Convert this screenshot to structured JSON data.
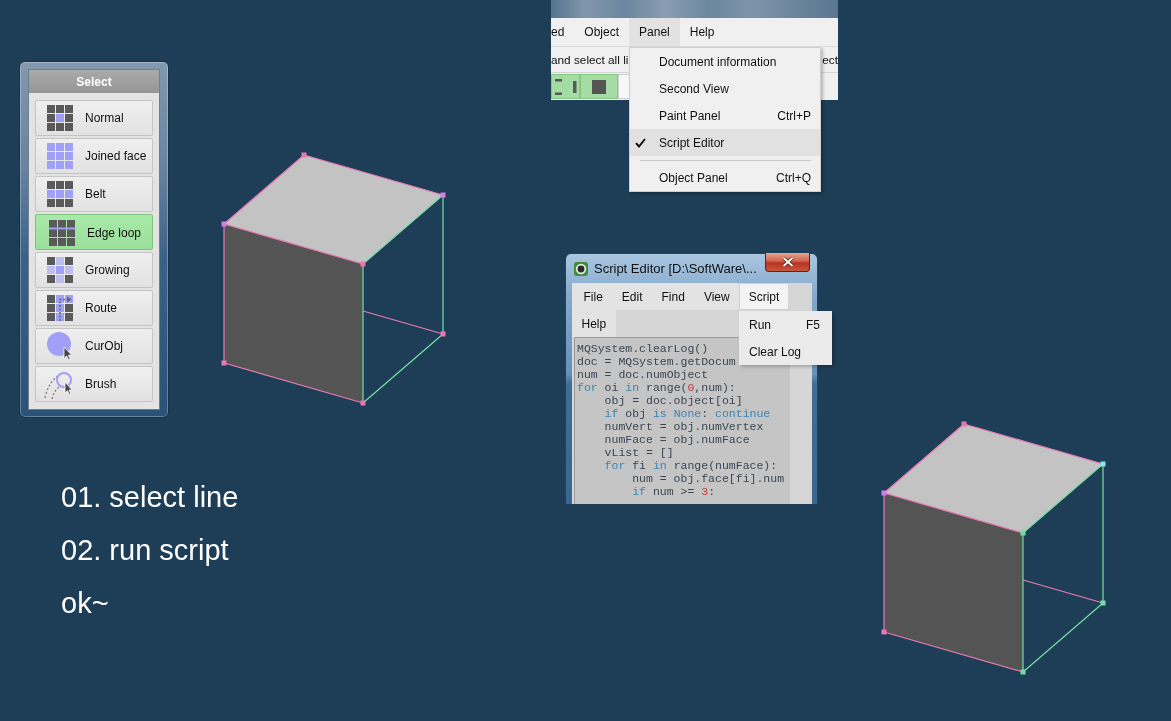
{
  "select_panel": {
    "title": "Select",
    "modes": [
      {
        "label": "Normal",
        "selected": false
      },
      {
        "label": "Joined face",
        "selected": false
      },
      {
        "label": "Belt",
        "selected": false
      },
      {
        "label": "Edge loop",
        "selected": true
      },
      {
        "label": "Growing",
        "selected": false
      },
      {
        "label": "Route",
        "selected": false
      },
      {
        "label": "CurObj",
        "selected": false
      },
      {
        "label": "Brush",
        "selected": false
      }
    ]
  },
  "main_window": {
    "menu_bar": [
      {
        "label": "ed",
        "selected": false
      },
      {
        "label": "Object",
        "selected": false
      },
      {
        "label": "Panel",
        "selected": true
      },
      {
        "label": "Help",
        "selected": false
      }
    ],
    "toolbar_text": "and select all li",
    "toolbar_text_right": "ect",
    "tool_buttons": [
      {
        "selected": true
      },
      {
        "selected": true
      },
      {
        "selected": false
      }
    ],
    "panel_menu": [
      {
        "kind": "item",
        "label": "Document information",
        "checked": false,
        "highlighted": false
      },
      {
        "kind": "item",
        "label": "Second View",
        "checked": false,
        "highlighted": false
      },
      {
        "kind": "item",
        "label": "Paint Panel",
        "shortcut": "Ctrl+P",
        "checked": false,
        "highlighted": false
      },
      {
        "kind": "item",
        "label": "Script Editor",
        "checked": true,
        "highlighted": true
      },
      {
        "kind": "separator"
      },
      {
        "kind": "item",
        "label": "Object Panel",
        "shortcut": "Ctrl+Q",
        "checked": false,
        "highlighted": false
      }
    ]
  },
  "cubes": [
    {
      "edges": [
        {
          "selected": false
        },
        {
          "selected": false
        },
        {
          "selected": false
        },
        {
          "selected": true
        },
        {
          "selected": false
        },
        {
          "selected": false
        },
        {
          "selected": true
        },
        {
          "selected": true
        },
        {
          "selected": true
        },
        {
          "selected": false
        }
      ],
      "vertices": [
        {
          "color": "#e878b4"
        },
        {
          "color": "#d47ee6"
        },
        {
          "color": "#d47ee6"
        },
        {
          "color": "#e878b4"
        },
        {
          "color": "#e878b4"
        },
        {
          "color": "#e878b4"
        },
        {
          "color": "#e878b4"
        }
      ]
    },
    {
      "edges": [
        {
          "selected": false
        },
        {
          "selected": false
        },
        {
          "selected": false
        },
        {
          "selected": true
        },
        {
          "selected": false
        },
        {
          "selected": false
        },
        {
          "selected": true
        },
        {
          "selected": true
        },
        {
          "selected": true
        },
        {
          "selected": false
        }
      ],
      "vertices": [
        {
          "color": "#e878b4"
        },
        {
          "color": "#80e6f0"
        },
        {
          "color": "#d47ee6"
        },
        {
          "color": "#70dea0"
        },
        {
          "color": "#e878b4"
        },
        {
          "color": "#70dea0"
        },
        {
          "color": "#70dea0"
        }
      ]
    }
  ],
  "script_editor": {
    "title": "Script Editor [D:\\SoftWare\\...",
    "menu_bar": [
      {
        "label": "File",
        "selected": false
      },
      {
        "label": "Edit",
        "selected": false
      },
      {
        "label": "Find",
        "selected": false
      },
      {
        "label": "View",
        "selected": false
      },
      {
        "label": "Script",
        "selected": true
      },
      {
        "label": "Help",
        "selected": false
      }
    ],
    "script_menu": [
      {
        "label": "Run",
        "shortcut": "F5"
      },
      {
        "label": "Clear Log"
      }
    ],
    "code": [
      [
        {
          "kind": "plain",
          "text": "MQSystem.clearLog()"
        }
      ],
      [
        {
          "kind": "plain",
          "text": "doc = MQSystem.getDocum"
        }
      ],
      [
        {
          "kind": "plain",
          "text": "num = doc.numObject"
        }
      ],
      [
        {
          "kind": "keyword",
          "text": "for"
        },
        {
          "kind": "plain",
          "text": " oi "
        },
        {
          "kind": "keyword",
          "text": "in"
        },
        {
          "kind": "plain",
          "text": " range("
        },
        {
          "kind": "number",
          "text": "0"
        },
        {
          "kind": "plain",
          "text": ",num):"
        }
      ],
      [
        {
          "kind": "plain",
          "text": "    obj = doc.object[oi]"
        }
      ],
      [
        {
          "kind": "keyword",
          "text": "    if"
        },
        {
          "kind": "plain",
          "text": " obj "
        },
        {
          "kind": "keyword",
          "text": "is None"
        },
        {
          "kind": "plain",
          "text": ": "
        },
        {
          "kind": "keyword",
          "text": "continue"
        }
      ],
      [
        {
          "kind": "plain",
          "text": "    numVert = obj.numVertex"
        }
      ],
      [
        {
          "kind": "plain",
          "text": "    numFace = obj.numFace"
        }
      ],
      [
        {
          "kind": "plain",
          "text": "    vList = []"
        }
      ],
      [
        {
          "kind": "keyword",
          "text": "    for"
        },
        {
          "kind": "plain",
          "text": " fi "
        },
        {
          "kind": "keyword",
          "text": "in"
        },
        {
          "kind": "plain",
          "text": " range(numFace):"
        }
      ],
      [
        {
          "kind": "plain",
          "text": "        num = obj.face[fi].num"
        }
      ],
      [
        {
          "kind": "keyword",
          "text": "        if"
        },
        {
          "kind": "plain",
          "text": " num >= "
        },
        {
          "kind": "number",
          "text": "3"
        },
        {
          "kind": "plain",
          "text": ":"
        }
      ]
    ]
  },
  "steps": [
    "01. select line",
    "02. run script",
    "ok~"
  ]
}
